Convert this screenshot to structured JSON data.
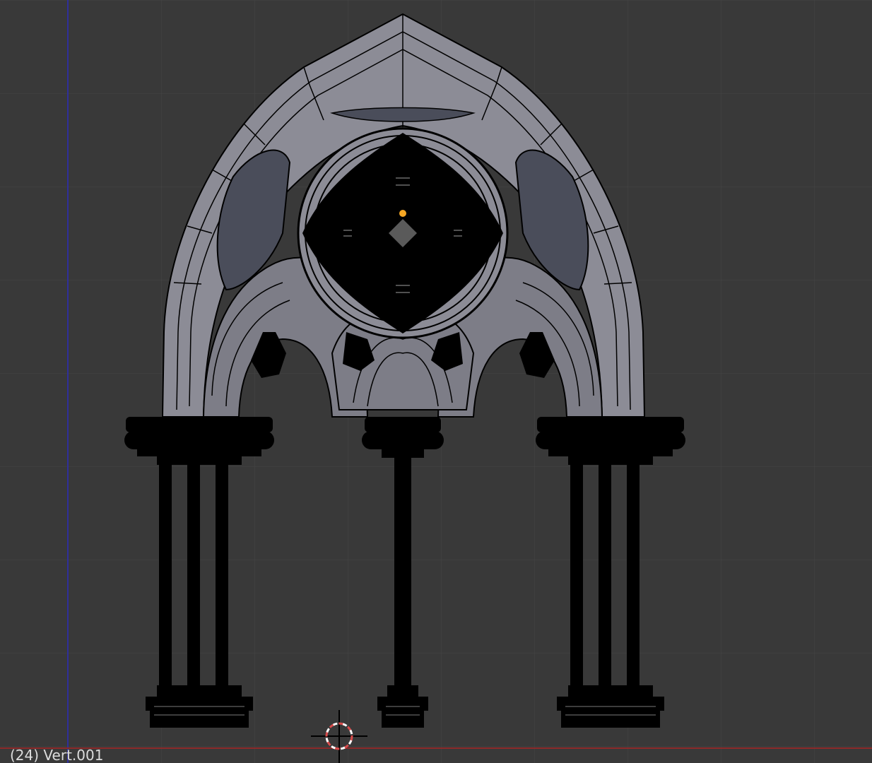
{
  "viewport": {
    "object_label": "(24) Vert.001",
    "background_color": "#393939",
    "grid_color": "#444444",
    "axis_colors": {
      "x_axis": "#8c2a2a",
      "z_axis": "#2a2a8c"
    }
  },
  "scene": {
    "model": "gothic-arch-wireframe",
    "mesh_face_color": "#8c8c96",
    "mesh_edge_color": "#000000",
    "recess_color": "#4a4d5a",
    "origin_color": "#f5a623",
    "cursor_icon": "3d-cursor-icon"
  }
}
